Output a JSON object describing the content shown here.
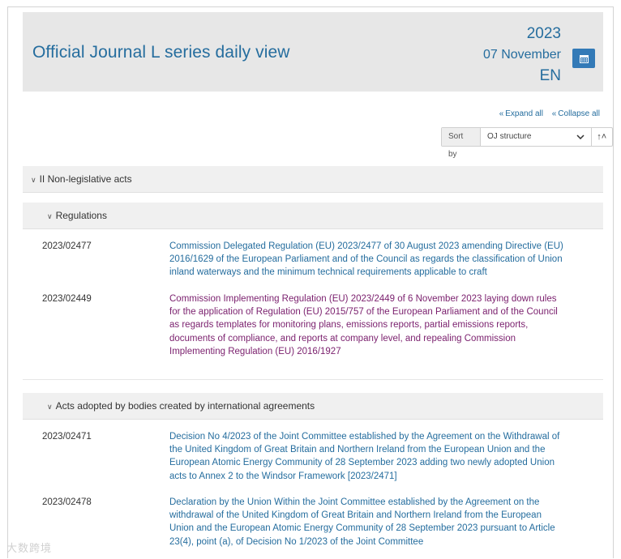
{
  "header": {
    "title": "Official Journal L series daily view",
    "year": "2023",
    "day": "07 November",
    "lang": "EN"
  },
  "toolbar": {
    "expand_all": "Expand all",
    "collapse_all": "Collapse all",
    "sort_label": "Sort by",
    "sort_value": "OJ structure"
  },
  "sections": {
    "non_legislative": "II Non-legislative acts",
    "regulations": "Regulations",
    "acts_bodies": "Acts adopted by bodies created by international agreements"
  },
  "regulations": [
    {
      "number": "2023/02477",
      "text": "Commission Delegated Regulation (EU) 2023/2477 of 30 August 2023 amending Directive (EU) 2016/1629 of the European Parliament and of the Council as regards the classification of Union inland waterways and the minimum technical requirements applicable to craft"
    },
    {
      "number": "2023/02449",
      "text": "Commission Implementing Regulation (EU) 2023/2449 of 6 November 2023 laying down rules for the application of Regulation (EU) 2015/757 of the European Parliament and of the Council as regards templates for monitoring plans, emissions reports, partial emissions reports, documents of compliance, and reports at company level, and repealing Commission Implementing Regulation (EU) 2016/1927"
    }
  ],
  "acts": [
    {
      "number": "2023/02471",
      "text": "Decision No 4/2023 of the Joint Committee established by the Agreement on the Withdrawal of the United Kingdom of Great Britain and Northern Ireland from the European Union and the European Atomic Energy Community of 28 September 2023 adding two newly adopted Union acts to Annex 2 to the Windsor Framework [2023/2471]"
    },
    {
      "number": "2023/02478",
      "text": "Declaration by the Union Within the Joint Committee established by the Agreement on the withdrawal of the United Kingdom of Great Britain and Northern Ireland from the European Union and the European Atomic Energy Community of 28 September 2023 pursuant to Article 23(4), point (a), of Decision No 1/2023 of the Joint Committee"
    }
  ],
  "watermark": "大数跨境",
  "colors": {
    "link": "#256d9e",
    "visited": "#7a1f6d",
    "button": "#337ab7"
  }
}
